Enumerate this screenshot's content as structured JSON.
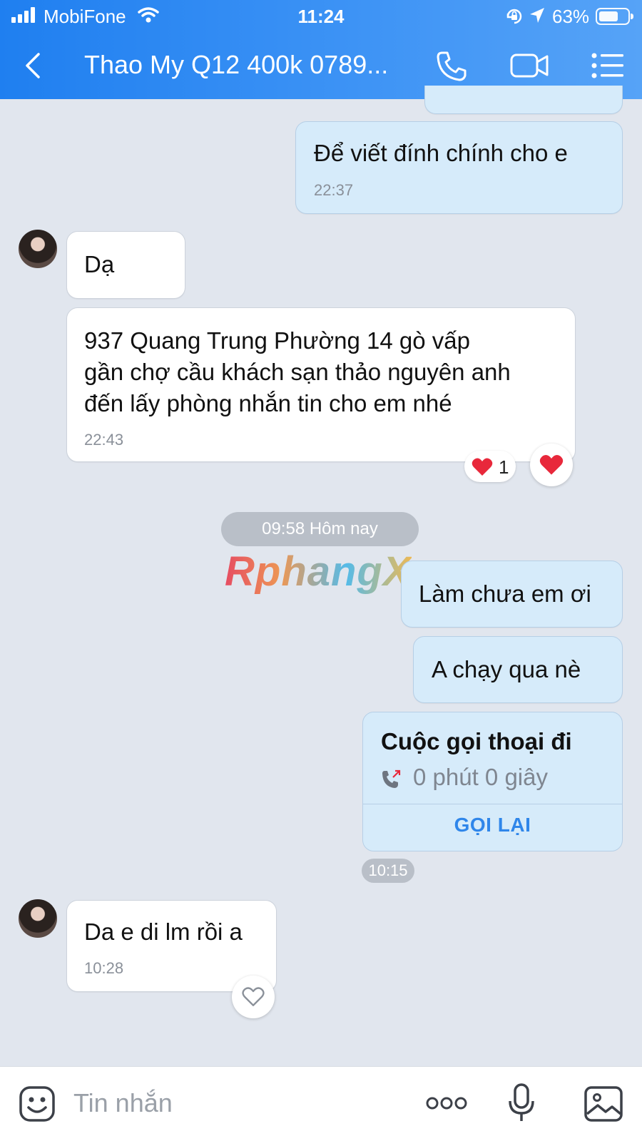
{
  "status_bar": {
    "carrier": "MobiFone",
    "time": "11:24",
    "battery": "63%"
  },
  "header": {
    "title": "Thao My Q12 400k 0789..."
  },
  "messages": [
    {
      "text": "Để viết đính chính cho e",
      "time": "22:37",
      "from": "me"
    },
    {
      "text": "Dạ",
      "from": "them"
    },
    {
      "lines": [
        "937 Quang Trung Phường 14 gò vấp",
        "gần chợ cầu khách sạn thảo nguyên anh",
        "đến lấy phòng nhắn tin cho em nhé"
      ],
      "time": "22:43",
      "from": "them",
      "reaction_count": "1"
    },
    {
      "text": "Làm chưa em ơi",
      "from": "me"
    },
    {
      "text": "A chạy qua nè",
      "from": "me"
    },
    {
      "text": "Da e di lm rồi a",
      "time": "10:28",
      "from": "them"
    }
  ],
  "date_separator": "09:58 Hôm nay",
  "call_card": {
    "title": "Cuộc gọi thoại đi",
    "duration": "0 phút 0 giây",
    "action": "GỌI LẠI",
    "time": "10:15"
  },
  "watermark": "RphangX",
  "composer": {
    "placeholder": "Tin nhắn"
  },
  "colors": {
    "header_start": "#1f7ff0",
    "header_end": "#56a3f7",
    "outgoing_bubble": "#d6ebfa",
    "incoming_bubble": "#ffffff",
    "chat_background": "#e1e6ee",
    "link_blue": "#2f86ea",
    "heart_red": "#e8283b"
  }
}
